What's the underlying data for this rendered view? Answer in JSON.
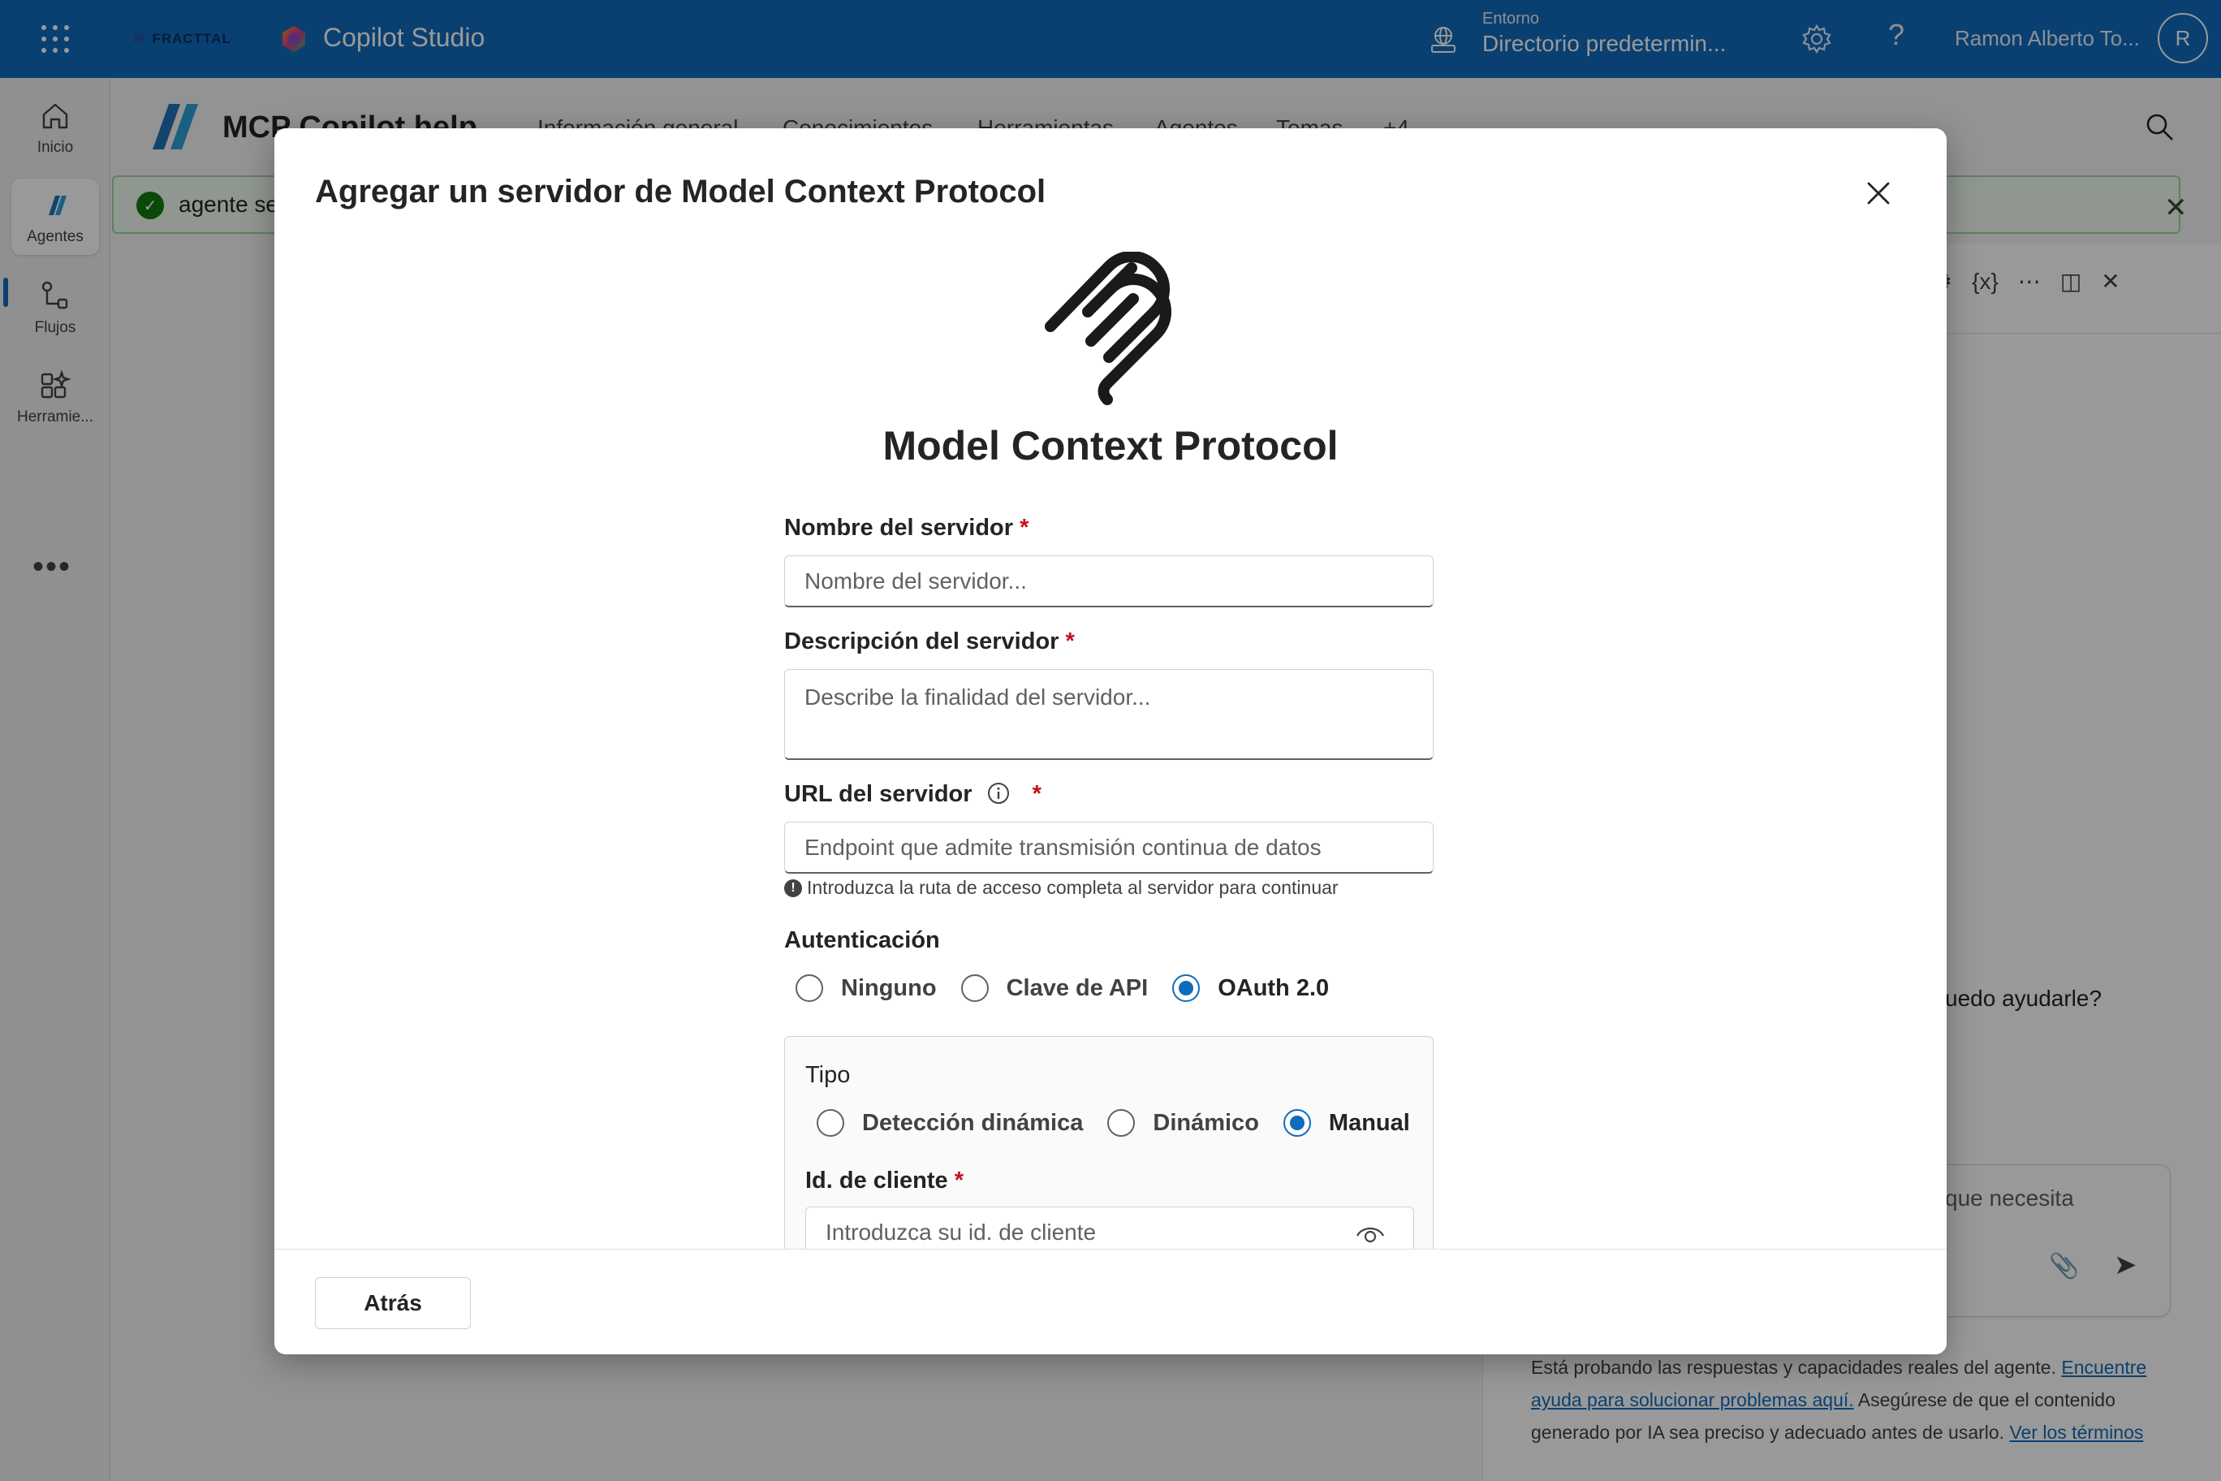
{
  "topbar": {
    "brand": "FRACTTAL",
    "app_title": "Copilot Studio",
    "environment_label": "Entorno",
    "environment_value": "Directorio predetermin...",
    "help_glyph": "?",
    "user_name": "Ramon Alberto To...",
    "avatar_initial": "R",
    "accent": "#0f6cbd"
  },
  "rail": {
    "items": [
      {
        "label": "Inicio",
        "icon": "home-icon"
      },
      {
        "label": "Agentes",
        "icon": "agents-icon"
      },
      {
        "label": "Flujos",
        "icon": "flows-icon"
      },
      {
        "label": "Herramie...",
        "icon": "tools-icon"
      }
    ],
    "more": "•••"
  },
  "page": {
    "agent_name": "MCP Copilot help",
    "tabs": [
      "Información general",
      "Conocimientos",
      "Herramientas",
      "Agentes",
      "Temas",
      "+4"
    ],
    "notice_text": "agente se",
    "greeting": "uedo ayudarle?",
    "compose_placeholder": "que necesita",
    "disclaimer": {
      "text1": "Está probando las respuestas y capacidades reales del agente.",
      "link1": "Encuentre ayuda para solucionar problemas aquí.",
      "text2": "Asegúrese de que el contenido generado por IA sea preciso y adecuado antes de usarlo.",
      "link2": "Ver los términos"
    }
  },
  "modal": {
    "title": "Agregar un servidor de Model Context Protocol",
    "logo_title": "Model Context Protocol",
    "required_mark": "*",
    "server_name": {
      "label": "Nombre del servidor",
      "placeholder": "Nombre del servidor...",
      "value": ""
    },
    "server_description": {
      "label": "Descripción del servidor",
      "placeholder": "Describe la finalidad del servidor...",
      "value": ""
    },
    "server_url": {
      "label": "URL del servidor",
      "placeholder": "Endpoint que admite transmisión continua de datos",
      "value": "",
      "hint": "Introduzca la ruta de acceso completa al servidor para continuar"
    },
    "authentication": {
      "label": "Autenticación",
      "options": [
        "Ninguno",
        "Clave de API",
        "OAuth 2.0"
      ],
      "selected": "OAuth 2.0"
    },
    "oauth": {
      "type_label": "Tipo",
      "type_options": [
        "Detección dinámica",
        "Dinámico",
        "Manual"
      ],
      "type_selected": "Manual",
      "client_id_label": "Id. de cliente",
      "client_id_placeholder": "Introduzca su id. de cliente"
    },
    "back_label": "Atrás"
  }
}
